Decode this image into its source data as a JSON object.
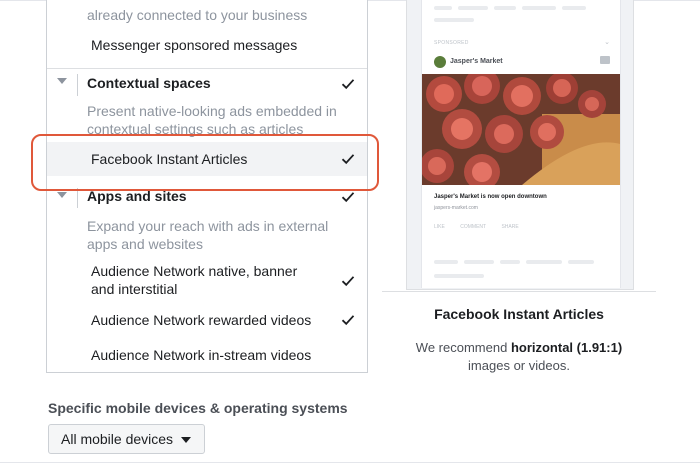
{
  "placements": {
    "top_desc": "already connected to your business",
    "messenger_sponsored": "Messenger sponsored messages",
    "contextual": {
      "label": "Contextual spaces",
      "description": "Present native-looking ads embedded in contextual settings such as articles",
      "items": [
        {
          "label": "Facebook Instant Articles",
          "checked": true
        }
      ]
    },
    "apps": {
      "label": "Apps and sites",
      "description": "Expand your reach with ads in external apps and websites",
      "items": [
        {
          "label": "Audience Network native, banner and interstitial",
          "checked": true
        },
        {
          "label": "Audience Network rewarded videos",
          "checked": true
        },
        {
          "label": "Audience Network in-stream videos",
          "checked": false
        }
      ]
    }
  },
  "preview": {
    "sponsored": "SPONSORED",
    "advertiser": "Jasper's Market",
    "caption": "Jasper's Market is now open downtown",
    "url": "jaspers-market.com",
    "actions": [
      "LIKE",
      "COMMENT",
      "SHARE"
    ],
    "title": "Facebook Instant Articles",
    "text_prefix": "We recommend ",
    "text_bold": "horizontal (1.91:1)",
    "text_suffix": "images or videos."
  },
  "devices": {
    "label": "Specific mobile devices & operating systems",
    "button": "All mobile devices"
  },
  "colors": {
    "accent": "#1877f2",
    "highlight": "#e0583a"
  }
}
